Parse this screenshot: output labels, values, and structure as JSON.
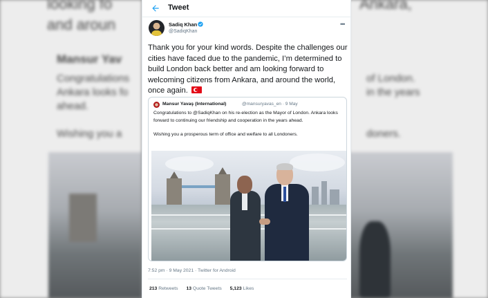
{
  "header": {
    "title": "Tweet"
  },
  "tweet": {
    "author_name": "Sadiq Khan",
    "author_handle": "@SadiqKhan",
    "text": "Thank you for your kind words. Despite the challenges our cities have faced due to the pandemic, I’m determined to build London back better and am looking forward to welcoming citizens from Ankara, and around the world, once again.",
    "timestamp": "7:52 pm · 9 May 2021 · Twitter for Android",
    "stats": {
      "retweets_count": "213",
      "retweets_label": "Retweets",
      "quotes_count": "13",
      "quotes_label": "Quote Tweets",
      "likes_count": "5,123",
      "likes_label": "Likes"
    }
  },
  "quoted_tweet": {
    "author_name": "Mansur Yavaş (International)",
    "meta": "@mansuryavas_en · 9 May",
    "text_para1": "Congratulations to @SadiqKhan on his re-election as the Mayor of London. Ankara looks forward to continuing our friendship and cooperation in the years ahead.",
    "text_para2": "Wishing you a prosperous term of office and welfare to all Londoners."
  },
  "background": {
    "left_lines": [
      "looking fo",
      "and aroun",
      "Mansur Yav",
      "Congratulations",
      "Ankara looks fo",
      "ahead.",
      "Wishing you a"
    ],
    "right_lines": [
      "Ankara,",
      "of London.",
      "in the years",
      "doners."
    ]
  },
  "colors": {
    "accent": "#1da1f2",
    "text": "#14171a",
    "muted": "#657786",
    "border": "#e6ecf0"
  }
}
